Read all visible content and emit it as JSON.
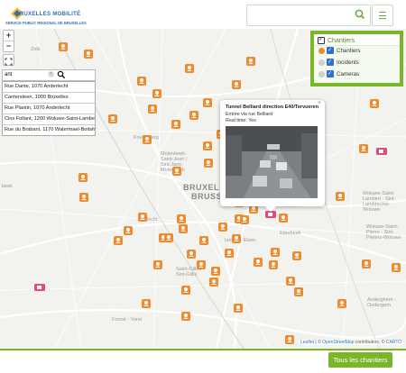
{
  "header": {
    "logo_title": "BRUXELLES MOBILITÉ",
    "logo_subtitle": "SERVICE PUBLIC RÉGIONAL DE BRUXELLES",
    "search_placeholder": "",
    "search_icon": "search-icon",
    "menu_icon": "hamburger-icon",
    "accent_color": "#79b729"
  },
  "map_controls": {
    "zoom_in": "+",
    "zoom_out": "−",
    "fullscreen_icon": "fullscreen-icon"
  },
  "address_search": {
    "query": "ant",
    "results": [
      "Rue Dante, 1070 Anderlecht",
      "Cantersteen, 1000 Bruxelles",
      "Rue Plantin, 1070 Anderlecht",
      "Clos Follant, 1200 Woluwe-Saint-Lambert",
      "Rue du Brabant, 1170 Watermael-Boitsfort"
    ]
  },
  "layers": {
    "title": "Chantiers",
    "items": [
      {
        "label": "Chantiers",
        "checked": true,
        "color": "#f08a2c"
      },
      {
        "label": "Incidents",
        "checked": true,
        "color": "#cfcfcf"
      },
      {
        "label": "Cameras",
        "checked": true,
        "color": "#cfcfcf"
      }
    ]
  },
  "popup": {
    "title": "Tunnel Belliard direction E40/Tervueren",
    "subtitle": "Entrée via rue Belliard",
    "time": "Real time: Yes",
    "close": "×"
  },
  "map_labels": {
    "zelk": "Zelk",
    "koekelberg": "Koekelberg",
    "molenbeek": "Molenbeek-Saint-Jean / Sint-Jans-Molenbeek",
    "bruxelles": "BRUXEL",
    "brussel": "BRUSSE",
    "ixelles": "Ixelles - Elsen",
    "etterbeek": "Etterbeek",
    "saint_gilles": "Saint-Gilles - Sint-Gillis",
    "woluwe_lambert": "Woluwe-Saint-Lambert - Sint-Lambrechts-Woluwe",
    "woluwe_pierre": "Woluwe-Saint-Pierre - Sint-Pieters-Woluwe",
    "forest": "Forest - Vorst",
    "auderghem": "Auderghem - Oudergem",
    "anderlecht": "lecht",
    "beek": "beek"
  },
  "attribution": {
    "leaflet": "Leaflet",
    "sep1": " | © ",
    "osm": "OpenStreetMap",
    "mid": " contributors, © ",
    "carto": "CARTO"
  },
  "footer": {
    "all_button": "Tous les chantiers"
  }
}
